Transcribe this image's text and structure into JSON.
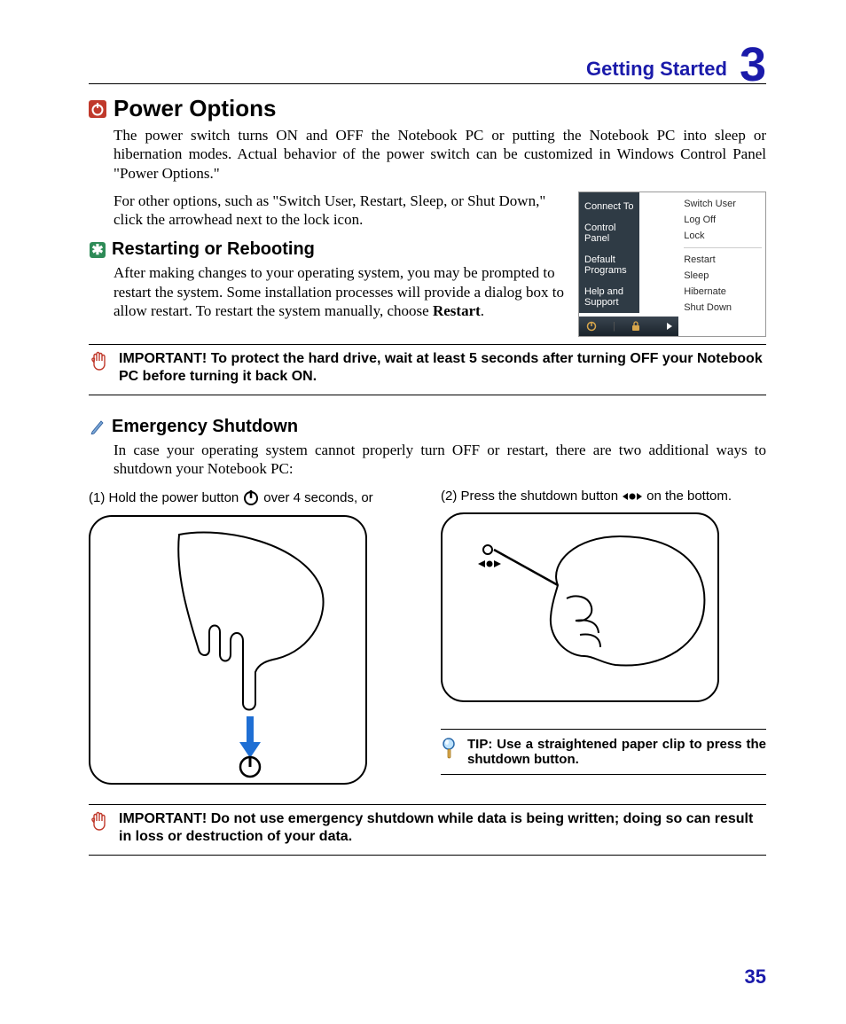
{
  "chapter": {
    "title": "Getting Started",
    "number": "3"
  },
  "section": {
    "title": "Power Options",
    "para1": "The power switch turns ON and OFF the Notebook PC or putting the Notebook PC into sleep or hibernation modes. Actual behavior of the power switch can be customized in Windows Control Panel \"Power Options.\"",
    "para2": "For other options, such as \"Switch User, Restart, Sleep, or Shut Down,\" click the arrowhead next to the lock icon."
  },
  "menu": {
    "left": [
      "Connect To",
      "Control Panel",
      "Default Programs",
      "Help and Support"
    ],
    "right_top": [
      "Switch User",
      "Log Off",
      "Lock"
    ],
    "right_bottom": [
      "Restart",
      "Sleep",
      "Hibernate",
      "Shut Down"
    ]
  },
  "restart": {
    "title": "Restarting or Rebooting",
    "para_a": "After making changes to your operating system, you may be prompted to restart the system. Some installation processes will provide a dialog box to allow restart. To restart the system manually, choose ",
    "para_b_bold": "Restart",
    "para_c": "."
  },
  "important1_prefix": "IMPORTANT!",
  "important1_rest": "  To protect the hard drive, wait at least 5 seconds after turning OFF your Notebook PC before turning it back ON.",
  "emergency": {
    "title": "Emergency Shutdown",
    "para": "In case your operating system cannot properly turn OFF or restart, there are two additional ways to shutdown your Notebook PC:"
  },
  "steps": {
    "s1a": "(1) Hold the power button ",
    "s1b": " over 4 seconds, or",
    "s2a": "(2) Press the shutdown button ",
    "s2b": " on the bottom."
  },
  "tip_prefix": "TIP:",
  "tip_rest": " Use a straightened paper clip to press the shutdown button.",
  "important2_prefix": "IMPORTANT!",
  "important2_rest": "  Do not use emergency shutdown while data is being written; doing so can result in loss or destruction of your data.",
  "page_number": "35"
}
